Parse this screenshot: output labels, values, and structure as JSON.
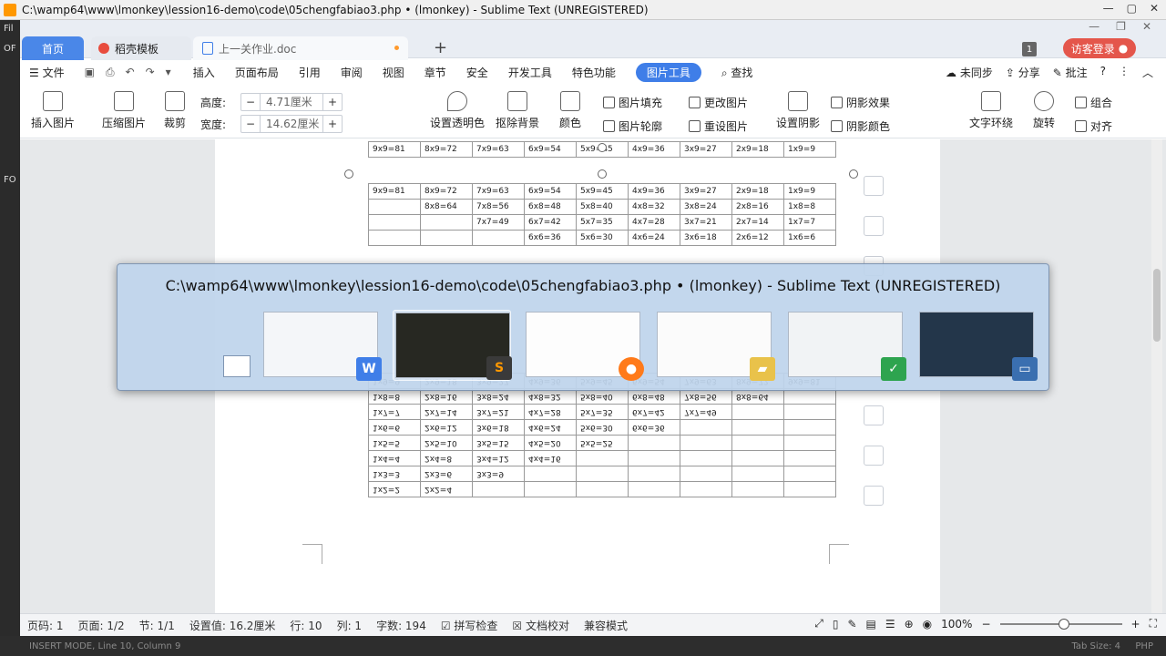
{
  "sublime": {
    "title": "C:\\wamp64\\www\\lmonkey\\lession16-demo\\code\\05chengfabiao3.php • (lmonkey) - Sublime Text (UNREGISTERED)",
    "status_left": "INSERT MODE, Line 10, Column 9",
    "status_tab": "Tab Size: 4",
    "status_syntax": "PHP",
    "left_frag": [
      "Fil",
      "OF",
      "FO"
    ]
  },
  "wps": {
    "tabs": {
      "home": "首页",
      "templates": "稻壳模板",
      "doc": "上一关作业.doc"
    },
    "badge": "1",
    "login": "访客登录",
    "menu": {
      "file": "文件",
      "items": [
        "插入",
        "页面布局",
        "引用",
        "审阅",
        "视图",
        "章节",
        "安全",
        "开发工具",
        "特色功能"
      ],
      "active": "图片工具",
      "search": "查找",
      "sync": "未同步",
      "share": "分享",
      "comment": "批注"
    },
    "ribbon": {
      "insert_pic": "插入图片",
      "compress": "压缩图片",
      "crop": "裁剪",
      "height_label": "高度:",
      "height_value": "4.71厘米",
      "width_label": "宽度:",
      "width_value": "14.62厘米",
      "transparent": "设置透明色",
      "remove_bg": "抠除背景",
      "color": "颜色",
      "fill": "图片填充",
      "outline": "图片轮廓",
      "change_pic": "更改图片",
      "reset_pic": "重设图片",
      "shadow": "设置阴影",
      "shadow_effect": "阴影效果",
      "shadow_color": "阴影颜色",
      "wrap": "文字环绕",
      "rotate": "旋转",
      "group": "组合",
      "align": "对齐"
    },
    "table_top": [
      "9x9=81",
      "8x9=72",
      "7x9=63",
      "6x9=54",
      "5x9=45",
      "4x9=36",
      "3x9=27",
      "2x9=18",
      "1x9=9"
    ],
    "table_rows": [
      [
        "9x9=81",
        "8x9=72",
        "7x9=63",
        "6x9=54",
        "5x9=45",
        "4x9=36",
        "3x9=27",
        "2x9=18",
        "1x9=9"
      ],
      [
        "",
        "8x8=64",
        "7x8=56",
        "6x8=48",
        "5x8=40",
        "4x8=32",
        "3x8=24",
        "2x8=16",
        "1x8=8"
      ],
      [
        "",
        "",
        "7x7=49",
        "6x7=42",
        "5x7=35",
        "4x7=28",
        "3x7=21",
        "2x7=14",
        "1x7=7"
      ],
      [
        "",
        "",
        "",
        "6x6=36",
        "5x6=30",
        "4x6=24",
        "3x6=18",
        "2x6=12",
        "1x6=6"
      ]
    ],
    "table_flipped": [
      [
        "1x2=2",
        "2x2=4",
        "",
        "",
        "",
        "",
        "",
        "",
        ""
      ],
      [
        "1x3=3",
        "2x3=6",
        "3x3=9",
        "",
        "",
        "",
        "",
        "",
        ""
      ],
      [
        "1x4=4",
        "2x4=8",
        "3x4=12",
        "4x4=16",
        "",
        "",
        "",
        "",
        ""
      ],
      [
        "1x5=5",
        "2x5=10",
        "3x5=15",
        "4x5=20",
        "5x5=25",
        "",
        "",
        "",
        ""
      ],
      [
        "1x6=6",
        "2x6=12",
        "3x6=18",
        "4x6=24",
        "5x6=30",
        "6x6=36",
        "",
        "",
        ""
      ],
      [
        "1x7=7",
        "2x7=14",
        "3x7=21",
        "4x7=28",
        "5x7=35",
        "6x7=42",
        "7x7=49",
        "",
        ""
      ],
      [
        "1x8=8",
        "2x8=16",
        "3x8=24",
        "4x8=32",
        "5x8=40",
        "6x8=48",
        "7x8=56",
        "8x8=64",
        ""
      ],
      [
        "1x9=9",
        "2x9=18",
        "3x9=27",
        "4x9=36",
        "5x9=45",
        "6x9=54",
        "7x9=63",
        "8x9=72",
        "9x9=81"
      ]
    ],
    "status": {
      "page_no": "页码: 1",
      "pages": "页面: 1/2",
      "section": "节: 1/1",
      "setting": "设置值: 16.2厘米",
      "row": "行: 10",
      "col": "列: 1",
      "words": "字数: 194",
      "spell": "拼写检查",
      "proof": "文档校对",
      "compat": "兼容模式",
      "zoom": "100%"
    }
  },
  "switcher": {
    "title": "C:\\wamp64\\www\\lmonkey\\lession16-demo\\code\\05chengfabiao3.php • (lmonkey) - Sublime Text (UNREGISTERED)",
    "apps": [
      "wps-writer",
      "sublime-text",
      "firefox",
      "file-explorer",
      "wps-other",
      "desktop"
    ]
  },
  "colors": {
    "wps_blue": "#3f7ee8",
    "login_red": "#e4564b",
    "switcher_bg": "#bed4ec",
    "sublime_orange": "#ff9800"
  }
}
